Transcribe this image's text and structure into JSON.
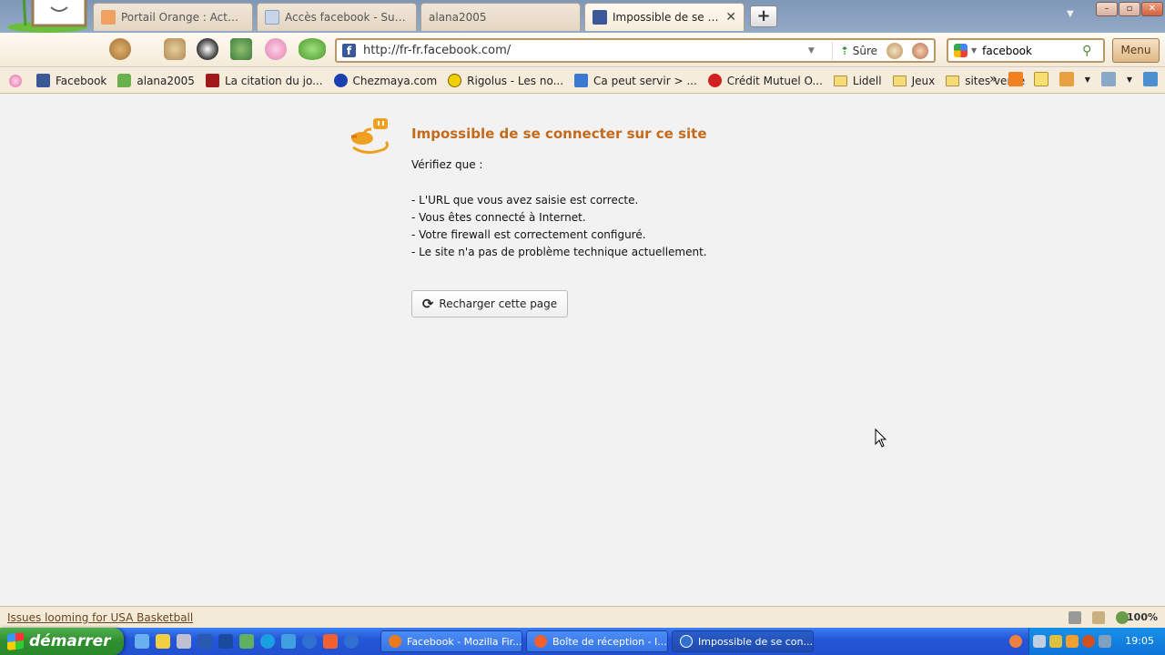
{
  "tabs": [
    {
      "title": "Portail Orange : Actu, Sp...",
      "active": false
    },
    {
      "title": "Accès facebook - Supp...",
      "active": false
    },
    {
      "title": "alana2005",
      "active": false
    },
    {
      "title": "Impossible de se con...",
      "active": true
    }
  ],
  "newtab_label": "+",
  "window_controls": {
    "minimize": "–",
    "maximize": "▫",
    "close": "✕"
  },
  "address": {
    "url": "http://fr-fr.facebook.com/",
    "safety_label": "Sûre"
  },
  "search": {
    "value": "facebook"
  },
  "menu_label": "Menu",
  "bookmarks": [
    {
      "label": "Facebook",
      "icon": "facebook-icon",
      "color": "#3b5998"
    },
    {
      "label": "alana2005",
      "icon": "chat-bubble-icon",
      "color": "#6ab04c"
    },
    {
      "label": "La citation du jo...",
      "icon": "citation-icon",
      "color": "#a01818"
    },
    {
      "label": "Chezmaya.com",
      "icon": "paw-icon",
      "color": "#1a3fb0"
    },
    {
      "label": "Rigolus - Les no...",
      "icon": "smiley-icon",
      "color": "#f0d000"
    },
    {
      "label": "Ca peut servir > ...",
      "icon": "gifs-icon",
      "color": "#3a7ad0"
    },
    {
      "label": "Crédit Mutuel O...",
      "icon": "credit-mutuel-icon",
      "color": "#d02020"
    },
    {
      "label": "Lidell",
      "icon": "folder-icon",
      "folder": true
    },
    {
      "label": "Jeux",
      "icon": "folder-icon",
      "folder": true
    },
    {
      "label": "sites vente",
      "icon": "folder-icon",
      "folder": true
    }
  ],
  "bookmarks_overflow": "»",
  "error": {
    "title": "Impossible de se connecter sur ce site",
    "intro": "Vérifiez que :",
    "items": [
      "- L'URL que vous avez saisie est correcte.",
      "- Vous êtes connecté à Internet.",
      "- Votre firewall est correctement configuré.",
      "- Le site n'a pas de problème technique actuellement."
    ],
    "reload_label": "Recharger cette page"
  },
  "statusbar": {
    "link": "Issues looming for USA Basketball",
    "zoom": "100%"
  },
  "taskbar": {
    "start_label": "démarrer",
    "tasks": [
      {
        "label": "Facebook - Mozilla Fir...",
        "icon_color": "#e87a20"
      },
      {
        "label": "Boîte de réception - I...",
        "icon_color": "#f06030"
      },
      {
        "label": "Impossible de se con...",
        "icon_color": "#3070d0"
      }
    ],
    "clock": "19:05"
  }
}
